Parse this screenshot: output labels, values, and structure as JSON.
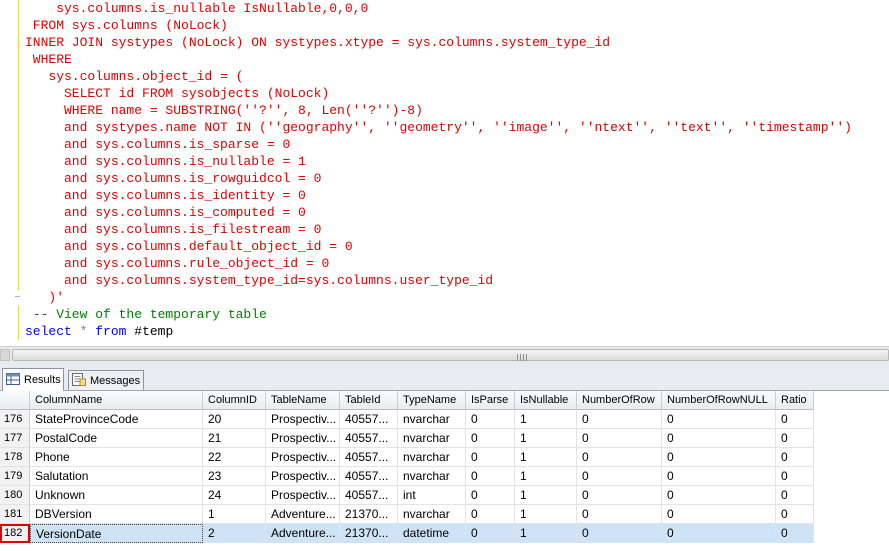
{
  "editor": {
    "lines": [
      [
        {
          "t": "    sys.columns.is_nullable IsNullable,0,0,0",
          "c": "red"
        }
      ],
      [
        {
          "t": " FROM sys.columns (NoLock)",
          "c": "red"
        }
      ],
      [
        {
          "t": "INNER JOIN systypes (NoLock) ON systypes.xtype = sys.columns.system_type_id",
          "c": "red"
        }
      ],
      [
        {
          "t": " WHERE",
          "c": "red"
        }
      ],
      [
        {
          "t": "   sys.columns.object_id = (",
          "c": "red"
        }
      ],
      [
        {
          "t": "     SELECT id FROM sysobjects (NoLock)",
          "c": "red"
        }
      ],
      [
        {
          "t": "     WHERE name = SUBSTRING(''?'', 8, Len(''?'')-8)",
          "c": "red"
        }
      ],
      [
        {
          "t": "     and systypes.name NOT IN (''geography'', ''geometry'', ''image'', ''ntext'', ''text'', ''timestamp'')",
          "c": "red"
        }
      ],
      [
        {
          "t": "     and sys.columns.is_sparse = 0",
          "c": "red"
        }
      ],
      [
        {
          "t": "     and sys.columns.is_nullable = 1",
          "c": "red"
        }
      ],
      [
        {
          "t": "     and sys.columns.is_rowguidcol = 0",
          "c": "red"
        }
      ],
      [
        {
          "t": "     and sys.columns.is_identity = 0",
          "c": "red"
        }
      ],
      [
        {
          "t": "     and sys.columns.is_computed = 0",
          "c": "red"
        }
      ],
      [
        {
          "t": "     and sys.columns.is_filestream = 0",
          "c": "red"
        }
      ],
      [
        {
          "t": "     and sys.columns.default_object_id = 0",
          "c": "red"
        }
      ],
      [
        {
          "t": "     and sys.columns.rule_object_id = 0",
          "c": "red"
        }
      ],
      [
        {
          "t": "     and sys.columns.system_type_id=sys.columns.user_type_id",
          "c": "red"
        }
      ],
      [
        {
          "t": "   )'",
          "c": "red"
        }
      ],
      [
        {
          "t": " -- View of the temporary table",
          "c": "cm"
        }
      ],
      [
        {
          "t": "select",
          "c": "kw"
        },
        {
          "t": " ",
          "c": "blk"
        },
        {
          "t": "*",
          "c": "gr"
        },
        {
          "t": " ",
          "c": "blk"
        },
        {
          "t": "from",
          "c": "kw"
        },
        {
          "t": " #temp",
          "c": "blk"
        }
      ]
    ]
  },
  "tabs": {
    "results": "Results",
    "messages": "Messages"
  },
  "grid": {
    "columns": [
      "ColumnName",
      "ColumnID",
      "TableName",
      "TableId",
      "TypeName",
      "IsParse",
      "IsNullable",
      "NumberOfRow",
      "NumberOfRowNULL",
      "Ratio"
    ],
    "rows": [
      {
        "n": "176",
        "v": [
          "StateProvinceCode",
          "20",
          "Prospectiv...",
          "40557...",
          "nvarchar",
          "0",
          "1",
          "0",
          "0",
          "0"
        ]
      },
      {
        "n": "177",
        "v": [
          "PostalCode",
          "21",
          "Prospectiv...",
          "40557...",
          "nvarchar",
          "0",
          "1",
          "0",
          "0",
          "0"
        ]
      },
      {
        "n": "178",
        "v": [
          "Phone",
          "22",
          "Prospectiv...",
          "40557...",
          "nvarchar",
          "0",
          "1",
          "0",
          "0",
          "0"
        ]
      },
      {
        "n": "179",
        "v": [
          "Salutation",
          "23",
          "Prospectiv...",
          "40557...",
          "nvarchar",
          "0",
          "1",
          "0",
          "0",
          "0"
        ]
      },
      {
        "n": "180",
        "v": [
          "Unknown",
          "24",
          "Prospectiv...",
          "40557...",
          "int",
          "0",
          "1",
          "0",
          "0",
          "0"
        ]
      },
      {
        "n": "181",
        "v": [
          "DBVersion",
          "1",
          "Adventure...",
          "21370...",
          "nvarchar",
          "0",
          "1",
          "0",
          "0",
          "0"
        ]
      },
      {
        "n": "182",
        "v": [
          "VersionDate",
          "2",
          "Adventure...",
          "21370...",
          "datetime",
          "0",
          "1",
          "0",
          "0",
          "0"
        ]
      }
    ],
    "selected_row": 6
  }
}
